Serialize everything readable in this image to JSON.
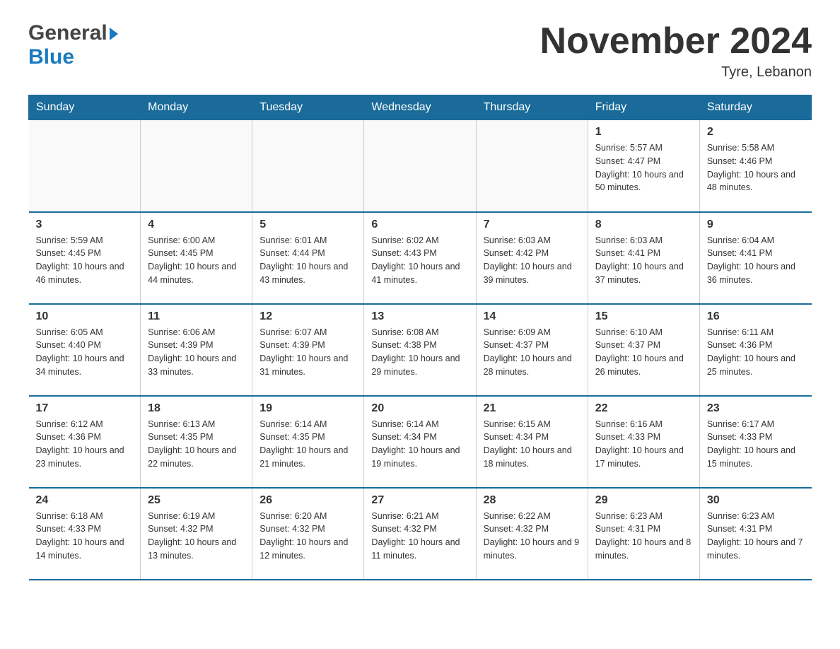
{
  "header": {
    "logo_general": "General",
    "logo_blue": "Blue",
    "month_title": "November 2024",
    "location": "Tyre, Lebanon"
  },
  "days_of_week": [
    "Sunday",
    "Monday",
    "Tuesday",
    "Wednesday",
    "Thursday",
    "Friday",
    "Saturday"
  ],
  "weeks": [
    {
      "days": [
        {
          "number": "",
          "info": ""
        },
        {
          "number": "",
          "info": ""
        },
        {
          "number": "",
          "info": ""
        },
        {
          "number": "",
          "info": ""
        },
        {
          "number": "",
          "info": ""
        },
        {
          "number": "1",
          "info": "Sunrise: 5:57 AM\nSunset: 4:47 PM\nDaylight: 10 hours and 50 minutes."
        },
        {
          "number": "2",
          "info": "Sunrise: 5:58 AM\nSunset: 4:46 PM\nDaylight: 10 hours and 48 minutes."
        }
      ]
    },
    {
      "days": [
        {
          "number": "3",
          "info": "Sunrise: 5:59 AM\nSunset: 4:45 PM\nDaylight: 10 hours and 46 minutes."
        },
        {
          "number": "4",
          "info": "Sunrise: 6:00 AM\nSunset: 4:45 PM\nDaylight: 10 hours and 44 minutes."
        },
        {
          "number": "5",
          "info": "Sunrise: 6:01 AM\nSunset: 4:44 PM\nDaylight: 10 hours and 43 minutes."
        },
        {
          "number": "6",
          "info": "Sunrise: 6:02 AM\nSunset: 4:43 PM\nDaylight: 10 hours and 41 minutes."
        },
        {
          "number": "7",
          "info": "Sunrise: 6:03 AM\nSunset: 4:42 PM\nDaylight: 10 hours and 39 minutes."
        },
        {
          "number": "8",
          "info": "Sunrise: 6:03 AM\nSunset: 4:41 PM\nDaylight: 10 hours and 37 minutes."
        },
        {
          "number": "9",
          "info": "Sunrise: 6:04 AM\nSunset: 4:41 PM\nDaylight: 10 hours and 36 minutes."
        }
      ]
    },
    {
      "days": [
        {
          "number": "10",
          "info": "Sunrise: 6:05 AM\nSunset: 4:40 PM\nDaylight: 10 hours and 34 minutes."
        },
        {
          "number": "11",
          "info": "Sunrise: 6:06 AM\nSunset: 4:39 PM\nDaylight: 10 hours and 33 minutes."
        },
        {
          "number": "12",
          "info": "Sunrise: 6:07 AM\nSunset: 4:39 PM\nDaylight: 10 hours and 31 minutes."
        },
        {
          "number": "13",
          "info": "Sunrise: 6:08 AM\nSunset: 4:38 PM\nDaylight: 10 hours and 29 minutes."
        },
        {
          "number": "14",
          "info": "Sunrise: 6:09 AM\nSunset: 4:37 PM\nDaylight: 10 hours and 28 minutes."
        },
        {
          "number": "15",
          "info": "Sunrise: 6:10 AM\nSunset: 4:37 PM\nDaylight: 10 hours and 26 minutes."
        },
        {
          "number": "16",
          "info": "Sunrise: 6:11 AM\nSunset: 4:36 PM\nDaylight: 10 hours and 25 minutes."
        }
      ]
    },
    {
      "days": [
        {
          "number": "17",
          "info": "Sunrise: 6:12 AM\nSunset: 4:36 PM\nDaylight: 10 hours and 23 minutes."
        },
        {
          "number": "18",
          "info": "Sunrise: 6:13 AM\nSunset: 4:35 PM\nDaylight: 10 hours and 22 minutes."
        },
        {
          "number": "19",
          "info": "Sunrise: 6:14 AM\nSunset: 4:35 PM\nDaylight: 10 hours and 21 minutes."
        },
        {
          "number": "20",
          "info": "Sunrise: 6:14 AM\nSunset: 4:34 PM\nDaylight: 10 hours and 19 minutes."
        },
        {
          "number": "21",
          "info": "Sunrise: 6:15 AM\nSunset: 4:34 PM\nDaylight: 10 hours and 18 minutes."
        },
        {
          "number": "22",
          "info": "Sunrise: 6:16 AM\nSunset: 4:33 PM\nDaylight: 10 hours and 17 minutes."
        },
        {
          "number": "23",
          "info": "Sunrise: 6:17 AM\nSunset: 4:33 PM\nDaylight: 10 hours and 15 minutes."
        }
      ]
    },
    {
      "days": [
        {
          "number": "24",
          "info": "Sunrise: 6:18 AM\nSunset: 4:33 PM\nDaylight: 10 hours and 14 minutes."
        },
        {
          "number": "25",
          "info": "Sunrise: 6:19 AM\nSunset: 4:32 PM\nDaylight: 10 hours and 13 minutes."
        },
        {
          "number": "26",
          "info": "Sunrise: 6:20 AM\nSunset: 4:32 PM\nDaylight: 10 hours and 12 minutes."
        },
        {
          "number": "27",
          "info": "Sunrise: 6:21 AM\nSunset: 4:32 PM\nDaylight: 10 hours and 11 minutes."
        },
        {
          "number": "28",
          "info": "Sunrise: 6:22 AM\nSunset: 4:32 PM\nDaylight: 10 hours and 9 minutes."
        },
        {
          "number": "29",
          "info": "Sunrise: 6:23 AM\nSunset: 4:31 PM\nDaylight: 10 hours and 8 minutes."
        },
        {
          "number": "30",
          "info": "Sunrise: 6:23 AM\nSunset: 4:31 PM\nDaylight: 10 hours and 7 minutes."
        }
      ]
    }
  ]
}
